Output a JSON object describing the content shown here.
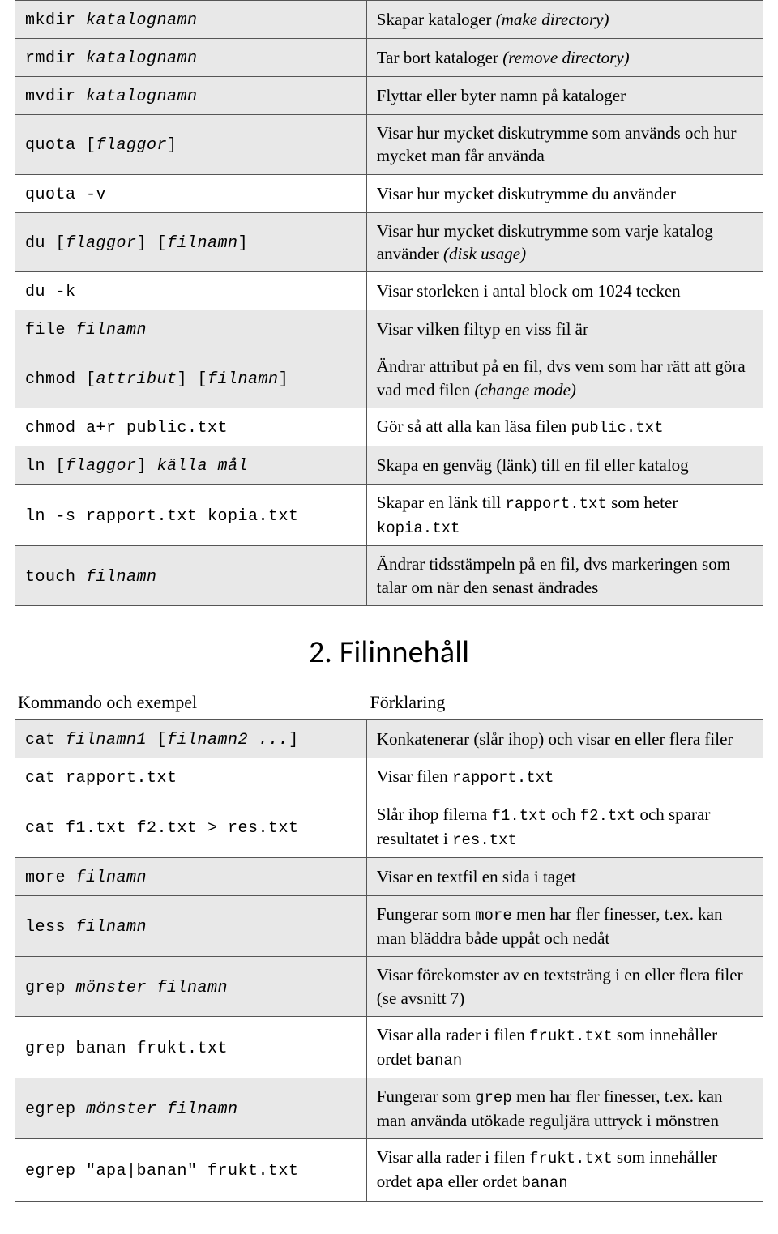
{
  "table1": {
    "rows": [
      {
        "shade": true,
        "cmd": [
          {
            "t": "mkdir ",
            "c": true
          },
          {
            "t": "katalognamn",
            "c": true,
            "i": true
          }
        ],
        "desc": [
          {
            "t": "Skapar kataloger "
          },
          {
            "t": "(make directory)",
            "i": true
          }
        ]
      },
      {
        "shade": true,
        "cmd": [
          {
            "t": "rmdir ",
            "c": true
          },
          {
            "t": "katalognamn",
            "c": true,
            "i": true
          }
        ],
        "desc": [
          {
            "t": "Tar bort kataloger "
          },
          {
            "t": "(remove directory)",
            "i": true
          }
        ]
      },
      {
        "shade": true,
        "cmd": [
          {
            "t": "mvdir ",
            "c": true
          },
          {
            "t": "katalognamn",
            "c": true,
            "i": true
          }
        ],
        "desc": [
          {
            "t": "Flyttar eller byter namn på kataloger"
          }
        ]
      },
      {
        "shade": true,
        "cmd": [
          {
            "t": "quota [",
            "c": true
          },
          {
            "t": "flaggor",
            "c": true,
            "i": true
          },
          {
            "t": "]",
            "c": true
          }
        ],
        "desc": [
          {
            "t": "Visar hur mycket diskutrymme som används och hur mycket man får använda"
          }
        ]
      },
      {
        "shade": false,
        "cmd": [
          {
            "t": "quota -v",
            "c": true
          }
        ],
        "desc": [
          {
            "t": "Visar hur mycket diskutrymme du använder"
          }
        ]
      },
      {
        "shade": true,
        "cmd": [
          {
            "t": "du [",
            "c": true
          },
          {
            "t": "flaggor",
            "c": true,
            "i": true
          },
          {
            "t": "] [",
            "c": true
          },
          {
            "t": "filnamn",
            "c": true,
            "i": true
          },
          {
            "t": "]",
            "c": true
          }
        ],
        "desc": [
          {
            "t": "Visar hur mycket diskutrymme som varje katalog använder "
          },
          {
            "t": "(disk usage)",
            "i": true
          }
        ]
      },
      {
        "shade": false,
        "cmd": [
          {
            "t": "du -k",
            "c": true
          }
        ],
        "desc": [
          {
            "t": "Visar storleken i antal block om 1024 tecken"
          }
        ]
      },
      {
        "shade": true,
        "cmd": [
          {
            "t": "file ",
            "c": true
          },
          {
            "t": "filnamn",
            "c": true,
            "i": true
          }
        ],
        "desc": [
          {
            "t": "Visar vilken filtyp en viss fil är"
          }
        ]
      },
      {
        "shade": true,
        "cmd": [
          {
            "t": "chmod [",
            "c": true
          },
          {
            "t": "attribut",
            "c": true,
            "i": true
          },
          {
            "t": "] [",
            "c": true
          },
          {
            "t": "filnamn",
            "c": true,
            "i": true
          },
          {
            "t": "]",
            "c": true
          }
        ],
        "desc": [
          {
            "t": "Ändrar attribut på en fil, dvs vem som har rätt att göra vad med filen "
          },
          {
            "t": "(change mode)",
            "i": true
          }
        ]
      },
      {
        "shade": false,
        "cmd": [
          {
            "t": "chmod a+r public.txt",
            "c": true
          }
        ],
        "desc": [
          {
            "t": "Gör så att alla kan läsa filen "
          },
          {
            "t": "public.txt",
            "m": true
          }
        ]
      },
      {
        "shade": true,
        "cmd": [
          {
            "t": "ln [",
            "c": true
          },
          {
            "t": "flaggor",
            "c": true,
            "i": true
          },
          {
            "t": "] ",
            "c": true
          },
          {
            "t": "källa mål",
            "c": true,
            "i": true
          }
        ],
        "desc": [
          {
            "t": "Skapa en genväg (länk) till en fil eller katalog"
          }
        ]
      },
      {
        "shade": false,
        "cmd": [
          {
            "t": "ln -s rapport.txt kopia.txt",
            "c": true
          }
        ],
        "desc": [
          {
            "t": "Skapar en länk till "
          },
          {
            "t": "rapport.txt",
            "m": true
          },
          {
            "t": " som heter "
          },
          {
            "t": "kopia.txt",
            "m": true
          }
        ]
      },
      {
        "shade": true,
        "cmd": [
          {
            "t": "touch ",
            "c": true
          },
          {
            "t": "filnamn",
            "c": true,
            "i": true
          }
        ],
        "desc": [
          {
            "t": "Ändrar tidsstämpeln på en fil, dvs markeringen som talar om när den senast ändrades"
          }
        ]
      }
    ]
  },
  "section2": {
    "title": "2. Filinnehåll",
    "col_left": "Kommando och exempel",
    "col_right": "Förklaring",
    "rows": [
      {
        "shade": true,
        "cmd": [
          {
            "t": "cat ",
            "c": true
          },
          {
            "t": "filnamn1",
            "c": true,
            "i": true
          },
          {
            "t": " [",
            "c": true
          },
          {
            "t": "filnamn2 ...",
            "c": true,
            "i": true
          },
          {
            "t": "]",
            "c": true
          }
        ],
        "desc": [
          {
            "t": "Konkatenerar (slår ihop) och visar en eller flera filer"
          }
        ]
      },
      {
        "shade": false,
        "cmd": [
          {
            "t": "cat rapport.txt",
            "c": true
          }
        ],
        "desc": [
          {
            "t": "Visar filen "
          },
          {
            "t": "rapport.txt",
            "m": true
          }
        ]
      },
      {
        "shade": false,
        "cmd": [
          {
            "t": "cat f1.txt f2.txt > res.txt",
            "c": true
          }
        ],
        "desc": [
          {
            "t": "Slår ihop filerna "
          },
          {
            "t": "f1.txt",
            "m": true
          },
          {
            "t": " och "
          },
          {
            "t": "f2.txt",
            "m": true
          },
          {
            "t": " och sparar resultatet i "
          },
          {
            "t": "res.txt",
            "m": true
          }
        ]
      },
      {
        "shade": true,
        "cmd": [
          {
            "t": "more ",
            "c": true
          },
          {
            "t": "filnamn",
            "c": true,
            "i": true
          }
        ],
        "desc": [
          {
            "t": "Visar en textfil en sida i taget"
          }
        ]
      },
      {
        "shade": true,
        "cmd": [
          {
            "t": "less ",
            "c": true
          },
          {
            "t": "filnamn",
            "c": true,
            "i": true
          }
        ],
        "desc": [
          {
            "t": "Fungerar som "
          },
          {
            "t": "more",
            "m": true
          },
          {
            "t": " men har fler finesser, t.ex. kan man bläddra både uppåt och nedåt"
          }
        ]
      },
      {
        "shade": true,
        "cmd": [
          {
            "t": "grep ",
            "c": true
          },
          {
            "t": "mönster filnamn",
            "c": true,
            "i": true
          }
        ],
        "desc": [
          {
            "t": "Visar förekomster av en textsträng i en eller flera filer (se avsnitt 7)"
          }
        ]
      },
      {
        "shade": false,
        "cmd": [
          {
            "t": "grep banan frukt.txt",
            "c": true
          }
        ],
        "desc": [
          {
            "t": "Visar alla rader i filen "
          },
          {
            "t": "frukt.txt",
            "m": true
          },
          {
            "t": " som innehåller ordet "
          },
          {
            "t": "banan",
            "m": true
          }
        ]
      },
      {
        "shade": true,
        "cmd": [
          {
            "t": "egrep ",
            "c": true
          },
          {
            "t": "mönster filnamn",
            "c": true,
            "i": true
          }
        ],
        "desc": [
          {
            "t": "Fungerar som "
          },
          {
            "t": "grep",
            "m": true
          },
          {
            "t": " men har fler finesser, t.ex. kan man använda utökade reguljära uttryck i mönstren"
          }
        ]
      },
      {
        "shade": false,
        "cmd": [
          {
            "t": "egrep \"apa|banan\" frukt.txt",
            "c": true
          }
        ],
        "desc": [
          {
            "t": "Visar alla rader i filen "
          },
          {
            "t": "frukt.txt",
            "m": true
          },
          {
            "t": " som innehåller ordet "
          },
          {
            "t": "apa",
            "m": true
          },
          {
            "t": " eller ordet "
          },
          {
            "t": "banan",
            "m": true
          }
        ]
      }
    ]
  }
}
